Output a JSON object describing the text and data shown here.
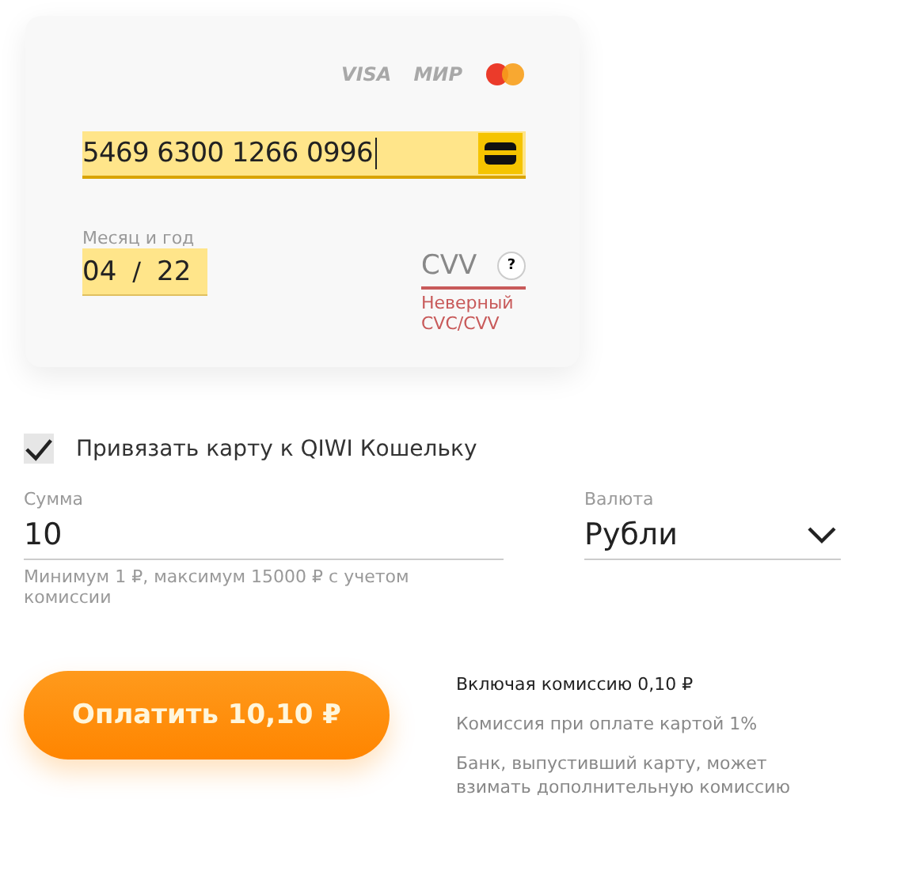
{
  "card": {
    "brands": [
      "VISA",
      "МИР"
    ],
    "number": "5469 6300 1266 0996",
    "expiry_label": "Месяц и год",
    "expiry_month": "04",
    "expiry_separator": "/",
    "expiry_year": "22",
    "cvv_placeholder": "CVV",
    "cvv_help": "?",
    "cvv_error": "Неверный CVC/CVV"
  },
  "link_card": {
    "label": "Привязать карту к QIWI Кошельку",
    "checked": true
  },
  "amount": {
    "label": "Сумма",
    "value": "10",
    "hint": "Минимум 1 ₽, максимум 15000 ₽ с учетом комиссии"
  },
  "currency": {
    "label": "Валюта",
    "value": "Рубли"
  },
  "pay_button": "Оплатить 10,10 ₽",
  "notes": [
    {
      "kind": "strong",
      "text": "Включая комиссию 0,10 ₽"
    },
    {
      "kind": "muted",
      "text": "Комиссия при оплате картой 1%"
    },
    {
      "kind": "muted",
      "text": "Банк, выпустивший карту, может взимать дополнительную комиссию"
    }
  ]
}
